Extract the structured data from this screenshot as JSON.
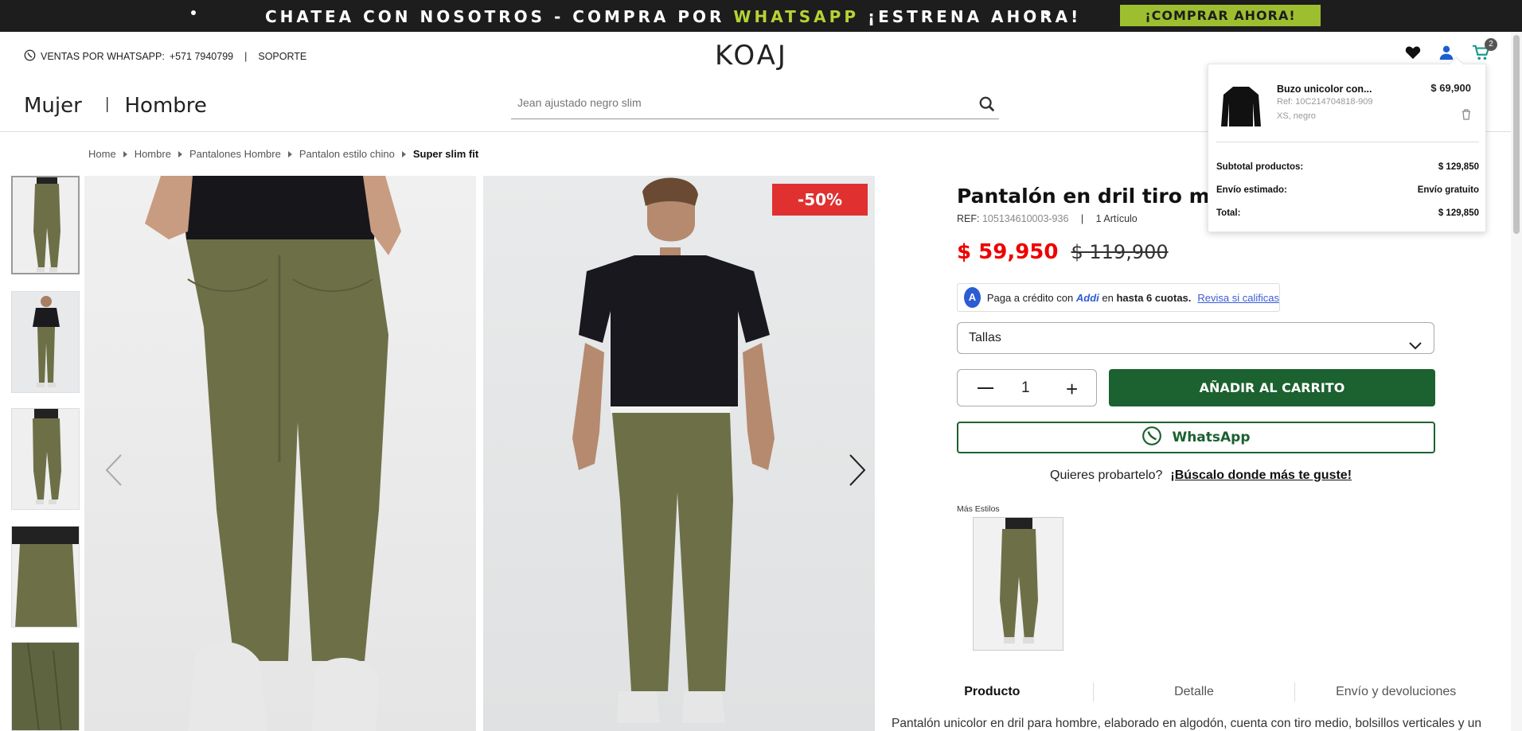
{
  "promo": {
    "message_pre": "CHATEA CON NOSOTROS - COMPRA POR ",
    "message_highlight": "WHATSAPP",
    "message_post": " ¡ESTRENA AHORA!",
    "cta_label": "¡COMPRAR AHORA!",
    "highlight_color": "#b5d334"
  },
  "header": {
    "whatsapp_label": "VENTAS POR WHATSAPP:",
    "whatsapp_phone": "+571 7940799",
    "support_label": "SOPORTE",
    "logo_text": "KOAJ",
    "cart_count": "2",
    "icons": [
      "whatsapp-icon",
      "heart-icon",
      "user-icon",
      "cart-icon"
    ]
  },
  "nav": {
    "items": [
      {
        "label": "Mujer"
      },
      {
        "label": "Hombre"
      }
    ]
  },
  "search": {
    "placeholder": "Jean ajustado negro slim"
  },
  "breadcrumb": {
    "items": [
      {
        "label": "Home"
      },
      {
        "label": "Hombre"
      },
      {
        "label": "Pantalones Hombre"
      },
      {
        "label": "Pantalon estilo chino"
      }
    ],
    "current": "Super slim fit"
  },
  "gallery": {
    "discount_badge": "-50%",
    "thumb_count": 5
  },
  "product": {
    "title": "Pantalón en dril tiro medio",
    "ref_label": "REF:",
    "ref_code": "105134610003-936",
    "ref_separator": "|",
    "quantity_note": "1 Artículo",
    "price_now": "$ 59,950",
    "price_old": "$ 119,900",
    "price_color": "#e00000",
    "addi": {
      "logo_letter": "A",
      "text_pre": "Paga a crédito con",
      "brand": "Addi",
      "text_mid": "en",
      "text_bold": "hasta 6 cuotas.",
      "link": "Revisa si calificas"
    },
    "sizes_label": "Tallas",
    "quantity": "1",
    "add_to_cart_label": "AÑADIR AL CARRITO",
    "whatsapp_button_label": "WhatsApp",
    "try_on_question": "Quieres probartelo?",
    "try_on_link": "¡Búscalo donde más te guste!",
    "more_styles_label": "Más Estilos",
    "accent_color": "#1c6130"
  },
  "tabs": [
    {
      "label": "Producto"
    },
    {
      "label": "Detalle"
    },
    {
      "label": "Envío y devoluciones"
    }
  ],
  "description": "Pantalón unicolor en dril para hombre, elaborado en algodón, cuenta con tiro medio, bolsillos verticales y un",
  "cart_popup": {
    "item": {
      "name": "Buzo unicolor con...",
      "ref": "Ref: 10C214704818-909",
      "variant": "XS, negro",
      "price": "$ 69,900"
    },
    "subtotal_label": "Subtotal productos:",
    "subtotal_value": "$ 129,850",
    "shipping_label": "Envío estimado:",
    "shipping_value": "Envío gratuito",
    "total_label": "Total:",
    "total_value": "$ 129,850"
  }
}
